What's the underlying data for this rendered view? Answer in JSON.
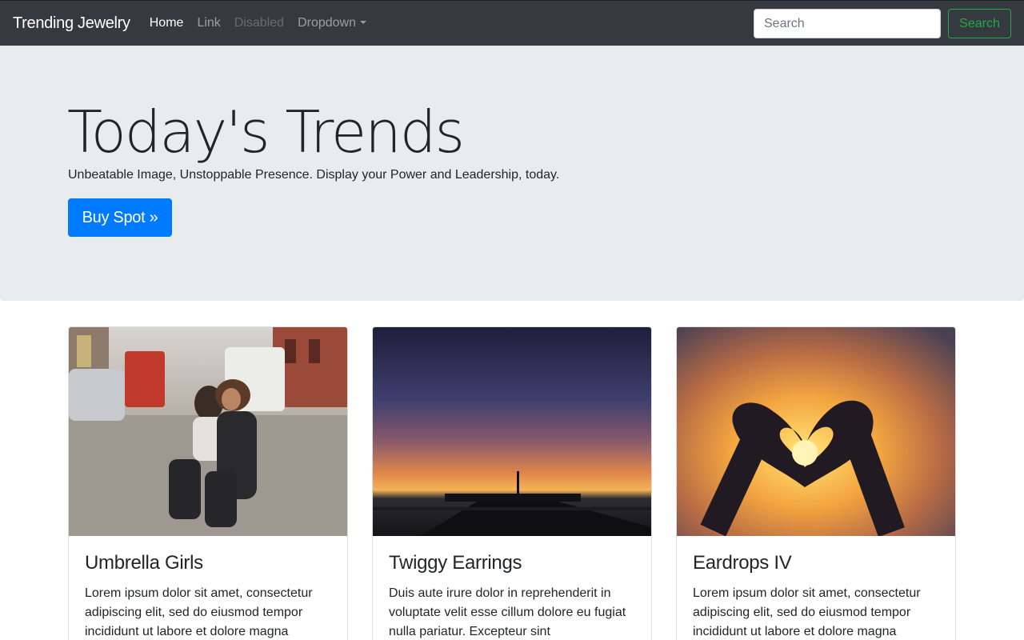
{
  "navbar": {
    "brand": "Trending Jewelry",
    "links": [
      {
        "label": "Home"
      },
      {
        "label": "Link"
      },
      {
        "label": "Disabled"
      },
      {
        "label": "Dropdown"
      }
    ],
    "search": {
      "placeholder": "Search",
      "value": "",
      "button_label": "Search"
    },
    "colors": {
      "background": "#343a40",
      "search_button": "#28a745"
    }
  },
  "hero": {
    "title": "Today's Trends",
    "lead": "Unbeatable Image, Unstoppable Presence. Display your Power and Leadership, today.",
    "button_label": "Buy Spot »",
    "colors": {
      "background": "#e9ecef",
      "button": "#007bff"
    }
  },
  "cards": [
    {
      "title": "Umbrella Girls",
      "text": "Lorem ipsum dolor sit amet, consectetur adipiscing elit, sed do eiusmod tempor incididunt ut labore et dolore magna",
      "image": "photo-mother-and-child-on-street"
    },
    {
      "title": "Twiggy Earrings",
      "text": "Duis aute irure dolor in reprehenderit in voluptate velit esse cillum dolore eu fugiat nulla pariatur. Excepteur sint",
      "image": "photo-sunset-over-pier"
    },
    {
      "title": "Eardrops IV",
      "text": "Lorem ipsum dolor sit amet, consectetur adipiscing elit, sed do eiusmod tempor incididunt ut labore et dolore magna",
      "image": "photo-heart-hands-sunset"
    }
  ]
}
